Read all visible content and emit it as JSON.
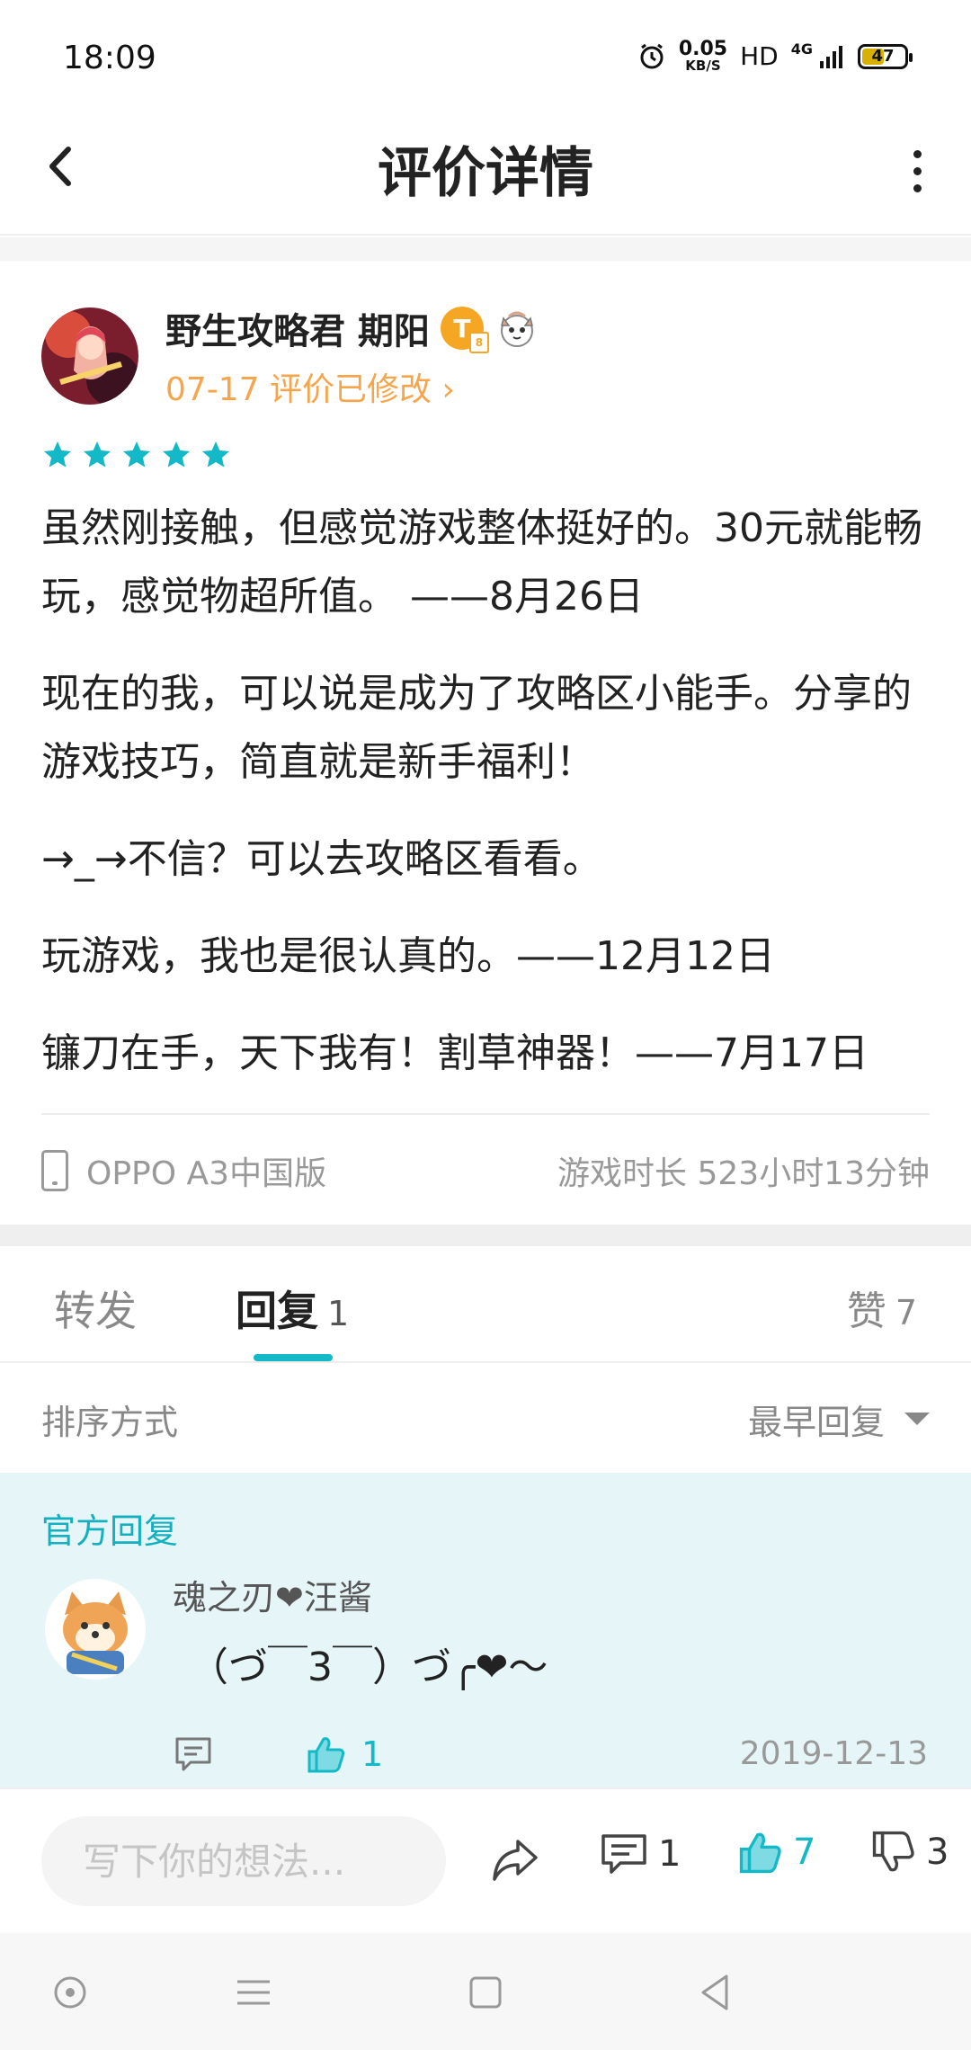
{
  "status_bar": {
    "time": "18:09",
    "speed_value": "0.05",
    "speed_unit": "KB/S",
    "hd": "HD",
    "network": "4G",
    "battery": "47"
  },
  "header": {
    "title": "评价详情"
  },
  "review": {
    "author_name": "野生攻略君 期阳",
    "badge_letter": "T",
    "edit_note": "07-17 评价已修改",
    "edit_chevron": "›",
    "rating": 5,
    "paragraphs": [
      "虽然刚接触，但感觉游戏整体挺好的。30元就能畅玩，感觉物超所值。 ——8月26日",
      "现在的我，可以说是成为了攻略区小能手。分享的游戏技巧，简直就是新手福利！",
      "→_→不信？可以去攻略区看看。",
      "玩游戏，我也是很认真的。——12月12日",
      "镰刀在手，天下我有！割草神器！——7月17日"
    ],
    "device": "OPPO A3中国版",
    "playtime": "游戏时长 523小时13分钟"
  },
  "tabs": {
    "forward": "转发",
    "reply": "回复",
    "reply_count": "1",
    "like": "赞",
    "like_count": "7"
  },
  "sort": {
    "label": "排序方式",
    "selected": "最早回复"
  },
  "official_reply": {
    "label": "官方回复",
    "name": "魂之刃❤汪酱",
    "text": "（づ￣3￣）づ╭❤～",
    "like_count": "1",
    "date": "2019-12-13"
  },
  "action_bar": {
    "input_placeholder": "写下你的想法...",
    "comment_count": "1",
    "like_count": "7",
    "dislike_count": "3"
  },
  "colors": {
    "accent": "#14b9c8",
    "edit_note": "#f5a64c",
    "official_bg": "#e6f6f8"
  }
}
